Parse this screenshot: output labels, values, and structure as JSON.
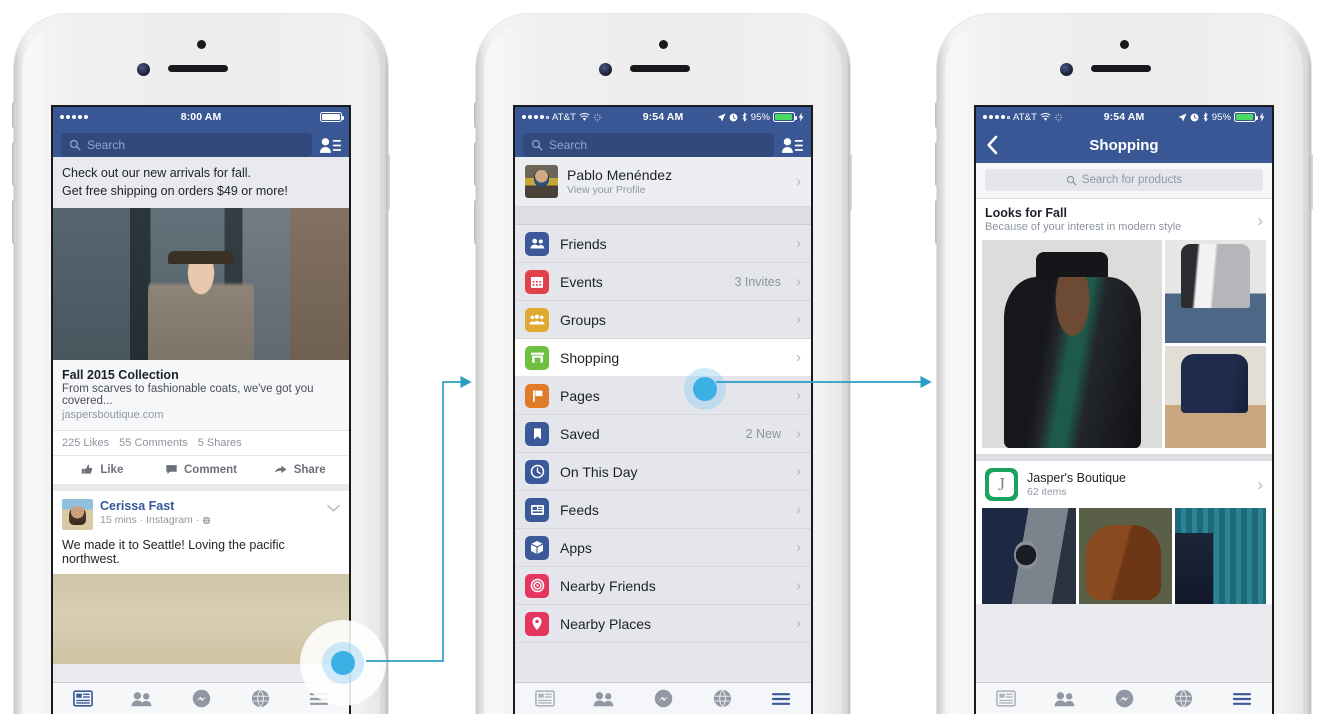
{
  "phones": [
    {
      "id": "phone-newsfeed",
      "status": {
        "carrier": "",
        "time": "8:00 AM",
        "battery_pct": "",
        "signal_dots": 5,
        "signal_filled": 5,
        "wifi": false,
        "battery_style": "white"
      },
      "search_placeholder": "Search",
      "promo": {
        "line1": "Check out our new arrivals for fall.",
        "line2": "Get free shipping on orders $49 or more!"
      },
      "link_card": {
        "title": "Fall 2015 Collection",
        "description": "From scarves to fashionable coats, we've got you covered...",
        "host": "jaspersboutique.com"
      },
      "counts": {
        "likes": "225 Likes",
        "comments": "55 Comments",
        "shares": "5 Shares"
      },
      "actions": [
        "Like",
        "Comment",
        "Share"
      ],
      "second_post": {
        "name": "Cerissa Fast",
        "meta": "15 mins · Instagram ·",
        "status": "We made it to Seattle! Loving the pacific northwest."
      },
      "tabs": [
        {
          "name": "news-feed",
          "active": true
        },
        {
          "name": "friend-requests",
          "active": false
        },
        {
          "name": "messenger",
          "active": false
        },
        {
          "name": "notifications",
          "active": false
        },
        {
          "name": "menu",
          "active": false
        }
      ]
    },
    {
      "id": "phone-menu",
      "status": {
        "carrier": "AT&T",
        "time": "9:54 AM",
        "battery_pct": "95%",
        "signal_dots": 5,
        "signal_filled": 4,
        "wifi": true,
        "battery_style": "green"
      },
      "search_placeholder": "Search",
      "profile": {
        "name": "Pablo Menéndez",
        "subtitle": "View your Profile"
      },
      "menu_items": [
        {
          "label": "Friends",
          "badge": "",
          "color": "#3b5998",
          "icon": "friends-icon",
          "active": false
        },
        {
          "label": "Events",
          "badge": "3 Invites",
          "color": "#e0414a",
          "icon": "calendar-icon",
          "active": false
        },
        {
          "label": "Groups",
          "badge": "",
          "color": "#e0a82e",
          "icon": "groups-icon",
          "active": false
        },
        {
          "label": "Shopping",
          "badge": "",
          "color": "#6fc041",
          "icon": "storefront-icon",
          "active": true
        },
        {
          "label": "Pages",
          "badge": "",
          "color": "#e07b28",
          "icon": "flag-icon",
          "active": false
        },
        {
          "label": "Saved",
          "badge": "2 New",
          "color": "#3b5998",
          "icon": "bookmark-icon",
          "active": false
        },
        {
          "label": "On This Day",
          "badge": "",
          "color": "#3b5998",
          "icon": "clock-icon",
          "active": false
        },
        {
          "label": "Feeds",
          "badge": "",
          "color": "#3b5998",
          "icon": "feeds-icon",
          "active": false
        },
        {
          "label": "Apps",
          "badge": "",
          "color": "#3b5998",
          "icon": "cube-icon",
          "active": false
        },
        {
          "label": "Nearby Friends",
          "badge": "",
          "color": "#e4365f",
          "icon": "radar-icon",
          "active": false
        },
        {
          "label": "Nearby Places",
          "badge": "",
          "color": "#e4365f",
          "icon": "location-pin-icon",
          "active": false
        }
      ],
      "tabs": [
        {
          "name": "news-feed",
          "active": false
        },
        {
          "name": "friend-requests",
          "active": false
        },
        {
          "name": "messenger",
          "active": false
        },
        {
          "name": "notifications",
          "active": false
        },
        {
          "name": "menu",
          "active": true
        }
      ]
    },
    {
      "id": "phone-shopping",
      "status": {
        "carrier": "AT&T",
        "time": "9:54 AM",
        "battery_pct": "95%",
        "signal_dots": 5,
        "signal_filled": 4,
        "wifi": true,
        "battery_style": "green"
      },
      "nav": {
        "back_label": "‹",
        "title": "Shopping"
      },
      "search_placeholder": "Search for products",
      "section": {
        "title": "Looks for Fall",
        "subtitle": "Because of your interest in modern style"
      },
      "store": {
        "name": "Jasper's Boutique",
        "items": "62 items",
        "logo_letter": "J",
        "logo_color": "#1aa260"
      },
      "tabs": [
        {
          "name": "news-feed",
          "active": false
        },
        {
          "name": "friend-requests",
          "active": false
        },
        {
          "name": "messenger",
          "active": false
        },
        {
          "name": "notifications",
          "active": false
        },
        {
          "name": "menu",
          "active": true
        }
      ]
    }
  ],
  "theme": {
    "fb_blue": "#3a5795",
    "accent_arrow": "#2a9ec4",
    "tap_blue": "#3bb0e5",
    "tab_active": "#3b5998"
  }
}
